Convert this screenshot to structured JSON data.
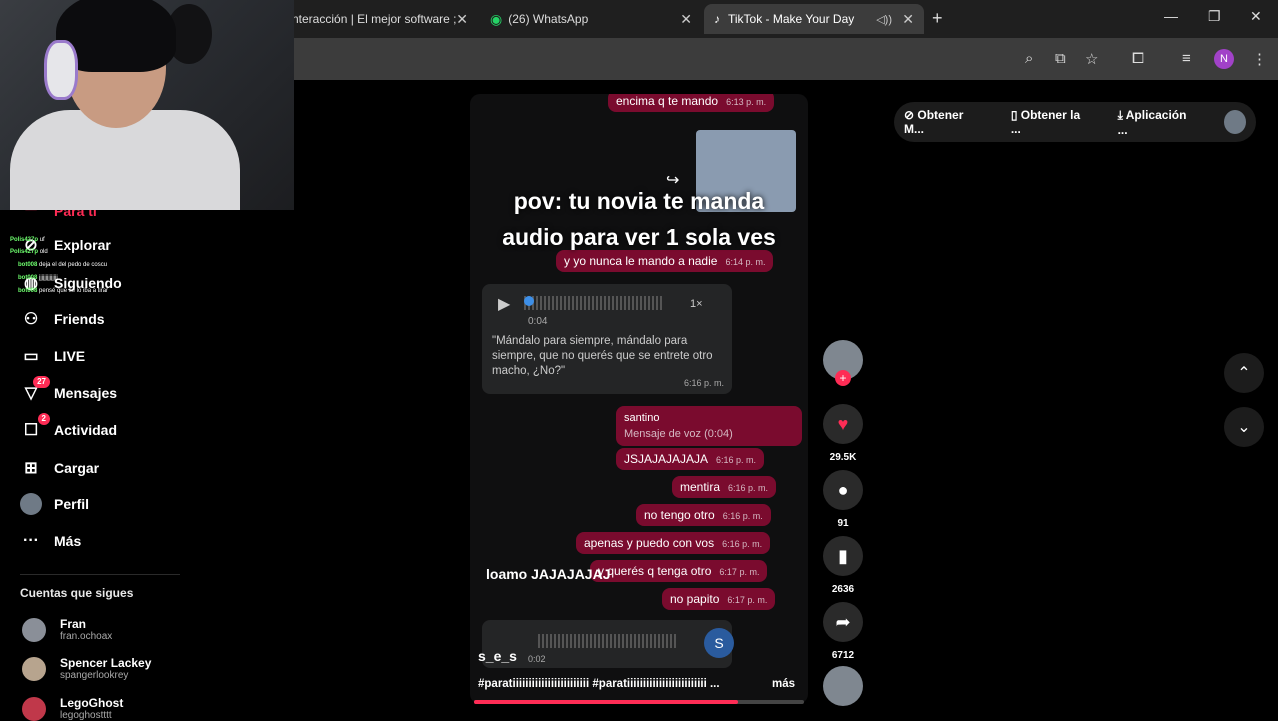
{
  "browser": {
    "tabs": [
      {
        "title": "nteracción | El mejor software ;",
        "active": false
      },
      {
        "title": "(26) WhatsApp",
        "active": false
      },
      {
        "title": "TikTok - Make Your Day",
        "active": true
      }
    ],
    "profile_initial": "N"
  },
  "sidebar": {
    "items": [
      {
        "label": "Para ti",
        "icon": "home-icon"
      },
      {
        "label": "Explorar",
        "icon": "compass-icon"
      },
      {
        "label": "Siguiendo",
        "icon": "following-icon"
      },
      {
        "label": "Friends",
        "icon": "friends-icon"
      },
      {
        "label": "LIVE",
        "icon": "live-icon"
      },
      {
        "label": "Mensajes",
        "icon": "messages-icon",
        "badge": "27"
      },
      {
        "label": "Actividad",
        "icon": "activity-icon",
        "badge": "2"
      },
      {
        "label": "Cargar",
        "icon": "upload-icon"
      },
      {
        "label": "Perfil",
        "icon": "profile-icon"
      },
      {
        "label": "Más",
        "icon": "more-icon"
      }
    ],
    "following_title": "Cuentas que sigues",
    "accounts": [
      {
        "name": "Fran",
        "handle": "fran.ochoax"
      },
      {
        "name": "Spencer Lackey",
        "handle": "spangerlookrey"
      },
      {
        "name": "LegoGhost",
        "handle": "legoghostttt"
      }
    ]
  },
  "stream_chat": [
    {
      "user": "Polis427p",
      "text": "uf"
    },
    {
      "user": "Polis427p",
      "text": "old"
    },
    {
      "user": "bot008",
      "text": "deja el del pedo de coscu"
    },
    {
      "user": "bot008",
      "text": "jjjjjjjjjjjjjj"
    },
    {
      "user": "bot008",
      "text": "pensé que se lo iba a tirar"
    }
  ],
  "header": {
    "get_app": "Obtener M...",
    "get_pc": "Obtener la ...",
    "download": "Aplicación ..."
  },
  "video": {
    "messages_top": {
      "text": "encima q te mando",
      "time": "6:13 p. m."
    },
    "overlay_line1": "pov: tu novia te manda",
    "overlay_line2": "audio para ver 1 sola ves",
    "reply_no": {
      "text": "y yo nunca le mando a nadie",
      "time": "6:14 p. m."
    },
    "audio": {
      "duration": "0:04",
      "speed": "1×",
      "transcript": "\"Mándalo para siempre, mándalo para siempre, que no querés que se entrete otro macho, ¿No?\"",
      "time": "6:16 p. m."
    },
    "quote": {
      "author": "santino",
      "label": "Mensaje de voz (0:04)"
    },
    "sent": [
      {
        "text": "JSJAJAJAJAJA",
        "time": "6:16 p. m."
      },
      {
        "text": "mentira",
        "time": "6:16 p. m."
      },
      {
        "text": "no tengo otro",
        "time": "6:16 p. m."
      },
      {
        "text": "apenas y puedo con vos",
        "time": "6:16 p. m."
      },
      {
        "text": "y querés q tenga otro",
        "time": "6:17 p. m."
      },
      {
        "text": "no papito",
        "time": "6:17 p. m."
      }
    ],
    "loamo": "loamo JAJAJAJAJ",
    "audio2_duration": "0:02",
    "audio2_initial": "S",
    "author": "s_e_s",
    "caption": "#paratiiiiiiiiiiiiiiiiiiiiiiii #paratiiiiiiiiiiiiiiiiiiiiiiiii ...",
    "more": "más",
    "progress": 0.8
  },
  "actions": {
    "likes": "29.5K",
    "comments": "91",
    "saves": "2636",
    "shares": "6712"
  },
  "colors": {
    "accent": "#fe2c55",
    "bubble": "#7a0b2e"
  }
}
